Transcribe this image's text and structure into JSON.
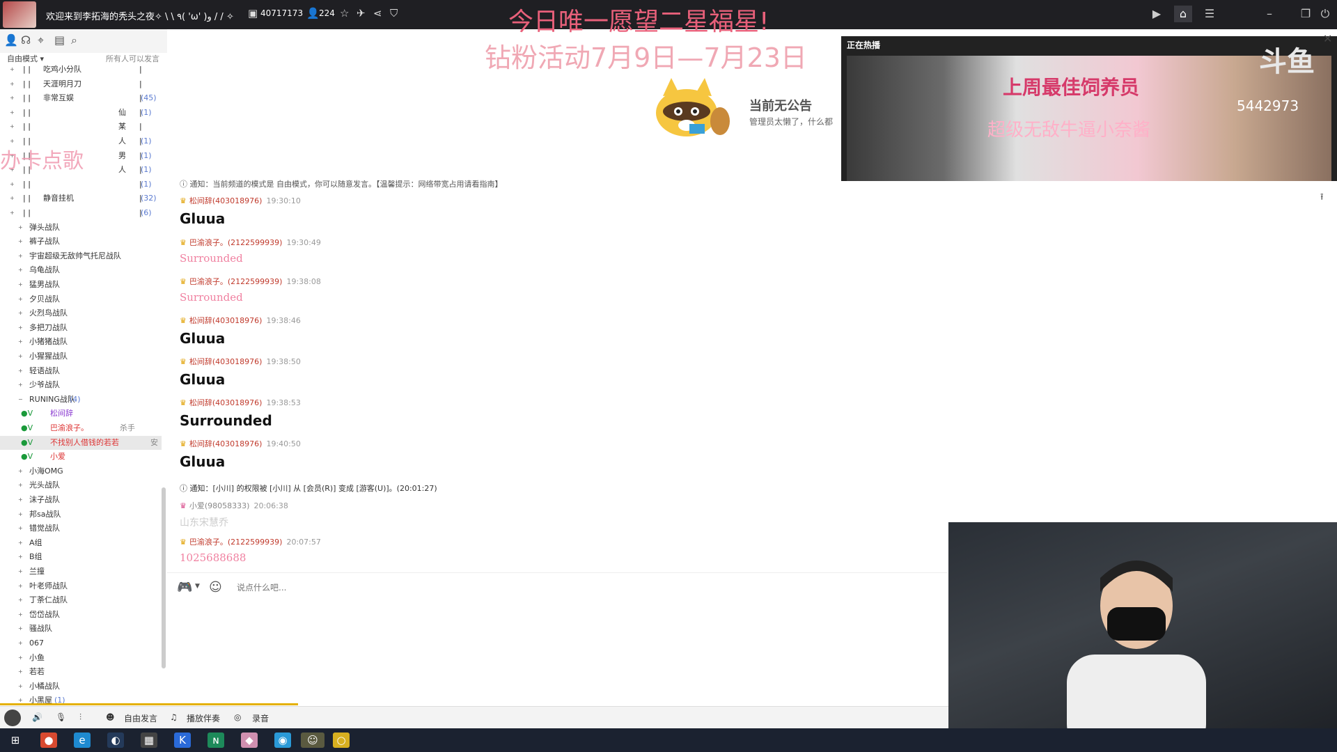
{
  "titlebar": {
    "room_title": "欢迎来到李拓海的秃头之夜✧ \\ \\ ٩( 'ω' )و / / ✧",
    "room_id": "40717173",
    "online_count": "224",
    "banner_top": "今日唯一愿望二星福星!",
    "banner_event": "钻粉活动7月9日—7月23日",
    "tb_icons": [
      "id-card-icon",
      "user-icon",
      "star-icon",
      "plane-icon",
      "share-icon",
      "shield-icon"
    ]
  },
  "left_toolbar": {
    "mode_label": "自由模式 ▾",
    "anyone_label": "所有人可以发言"
  },
  "tree": {
    "watermark": "办卡点歌",
    "rows": [
      {
        "name": "吃鸡小分队",
        "count": ""
      },
      {
        "name": "天涯明月刀",
        "count": ""
      },
      {
        "name": "非常互娱",
        "count": "(45)"
      },
      {
        "name": "仙",
        "count": "(1)"
      },
      {
        "name": "某",
        "count": ""
      },
      {
        "name": "人",
        "count": "(1)"
      },
      {
        "name": "男",
        "count": "(1)"
      },
      {
        "name": "人",
        "count": "(1)"
      },
      {
        "name": "",
        "count": "(1)"
      },
      {
        "name": "静音挂机",
        "count": "(32)"
      },
      {
        "name": "",
        "count": "(6)"
      }
    ],
    "teams": [
      "弹头战队",
      "裤子战队",
      "宇宙超级无敌帅气托尼战队",
      "乌龟战队",
      "猛男战队",
      "夕贝战队",
      "火烈鸟战队",
      "多把刀战队",
      "小猪猪战队",
      "小猩猩战队",
      "轻语战队",
      "少爷战队"
    ],
    "running": {
      "name": "RUNING战队",
      "count": "(4)"
    },
    "users": [
      {
        "name": "松间辞",
        "role": ""
      },
      {
        "name": "巴渝浪子。",
        "role": "杀手"
      },
      {
        "name": "不找别人借钱的若若",
        "role": "安"
      },
      {
        "name": "小爱",
        "role": ""
      }
    ],
    "teams2": [
      "小海OMG",
      "光头战队",
      "沫子战队",
      "邦sa战队",
      "错觉战队",
      "A组",
      "B组",
      "兰撞",
      "叶老师战队",
      "丁荼仁战队",
      "岱岱战队",
      "骚战队",
      "067",
      "小鱼",
      "若若",
      "小橘战队"
    ],
    "last": {
      "name": "小黑屋",
      "count": "(1)"
    }
  },
  "notice": {
    "title": "当前无公告",
    "sub": "管理员太懒了，什么都"
  },
  "hot": {
    "label": "正在热播",
    "headline": "上周最佳饲养员",
    "subline": "超级无敌牛逼小奈酱",
    "fans": "5442973",
    "logo": "斗鱼"
  },
  "chat": {
    "sys0": "通知：当前频道的模式是 自由模式，你可以随意发言。【温馨提示：网络带宽占用请看指南】",
    "messages": [
      {
        "user": "松间辞(403018976)",
        "time": "19:30:10",
        "text": "Gluua",
        "style": "big"
      },
      {
        "user": "巴渝浪子。(2122599939)",
        "time": "19:30:49",
        "text": "Surrounded",
        "style": "pink"
      },
      {
        "user": "巴渝浪子。(2122599939)",
        "time": "19:38:08",
        "text": "Surrounded",
        "style": "pink"
      },
      {
        "user": "松间辞(403018976)",
        "time": "19:38:46",
        "text": "Gluua",
        "style": "big"
      },
      {
        "user": "松间辞(403018976)",
        "time": "19:38:50",
        "text": "Gluua",
        "style": "big"
      },
      {
        "user": "松间辞(403018976)",
        "time": "19:38:53",
        "text": "Surrounded",
        "style": "big"
      },
      {
        "user": "松间辞(403018976)",
        "time": "19:40:50",
        "text": "Gluua",
        "style": "big"
      }
    ],
    "sys1": "通知：[小川] 的权限被 [小川] 从 [会员(R)] 变成 [游客(U)]。(20:01:27)",
    "messages2": [
      {
        "user": "小爱(98058333)",
        "time": "20:06:38",
        "text": "山东宋慧乔",
        "style": "grey"
      },
      {
        "user": "巴渝浪子。(2122599939)",
        "time": "20:07:57",
        "text": "1025688688",
        "style": "pink"
      }
    ]
  },
  "input": {
    "placeholder": "说点什么吧..."
  },
  "bottombar": {
    "free_speak": "自由发言",
    "play_music": "播放伴奏",
    "record": "录音"
  }
}
